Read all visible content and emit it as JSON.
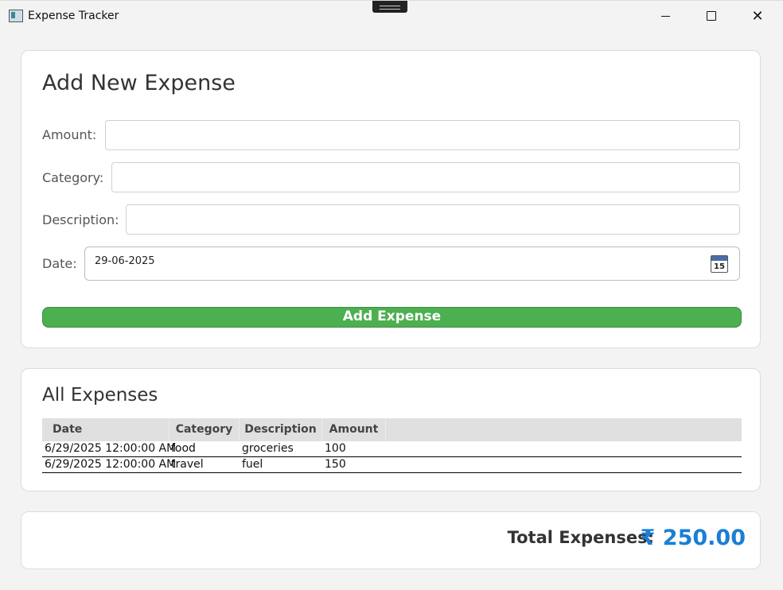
{
  "window": {
    "title": "Expense Tracker"
  },
  "form": {
    "heading": "Add New Expense",
    "amount_label": "Amount:",
    "amount_value": "",
    "category_label": "Category:",
    "category_value": "",
    "description_label": "Description:",
    "description_value": "",
    "date_label": "Date:",
    "date_value": "29-06-2025",
    "calendar_day": "15",
    "submit_label": "Add Expense"
  },
  "list": {
    "heading": "All Expenses",
    "columns": [
      "Date",
      "Category",
      "Description",
      "Amount"
    ],
    "rows": [
      [
        "6/29/2025 12:00:00 AM",
        "food",
        "groceries",
        "100"
      ],
      [
        "6/29/2025 12:00:00 AM",
        "travel",
        "fuel",
        "150"
      ]
    ]
  },
  "summary": {
    "total_label": "Total Expenses:",
    "total_value": "₹ 250.00"
  },
  "colors": {
    "accent": "#4caf50",
    "total": "#1a7fd4"
  }
}
